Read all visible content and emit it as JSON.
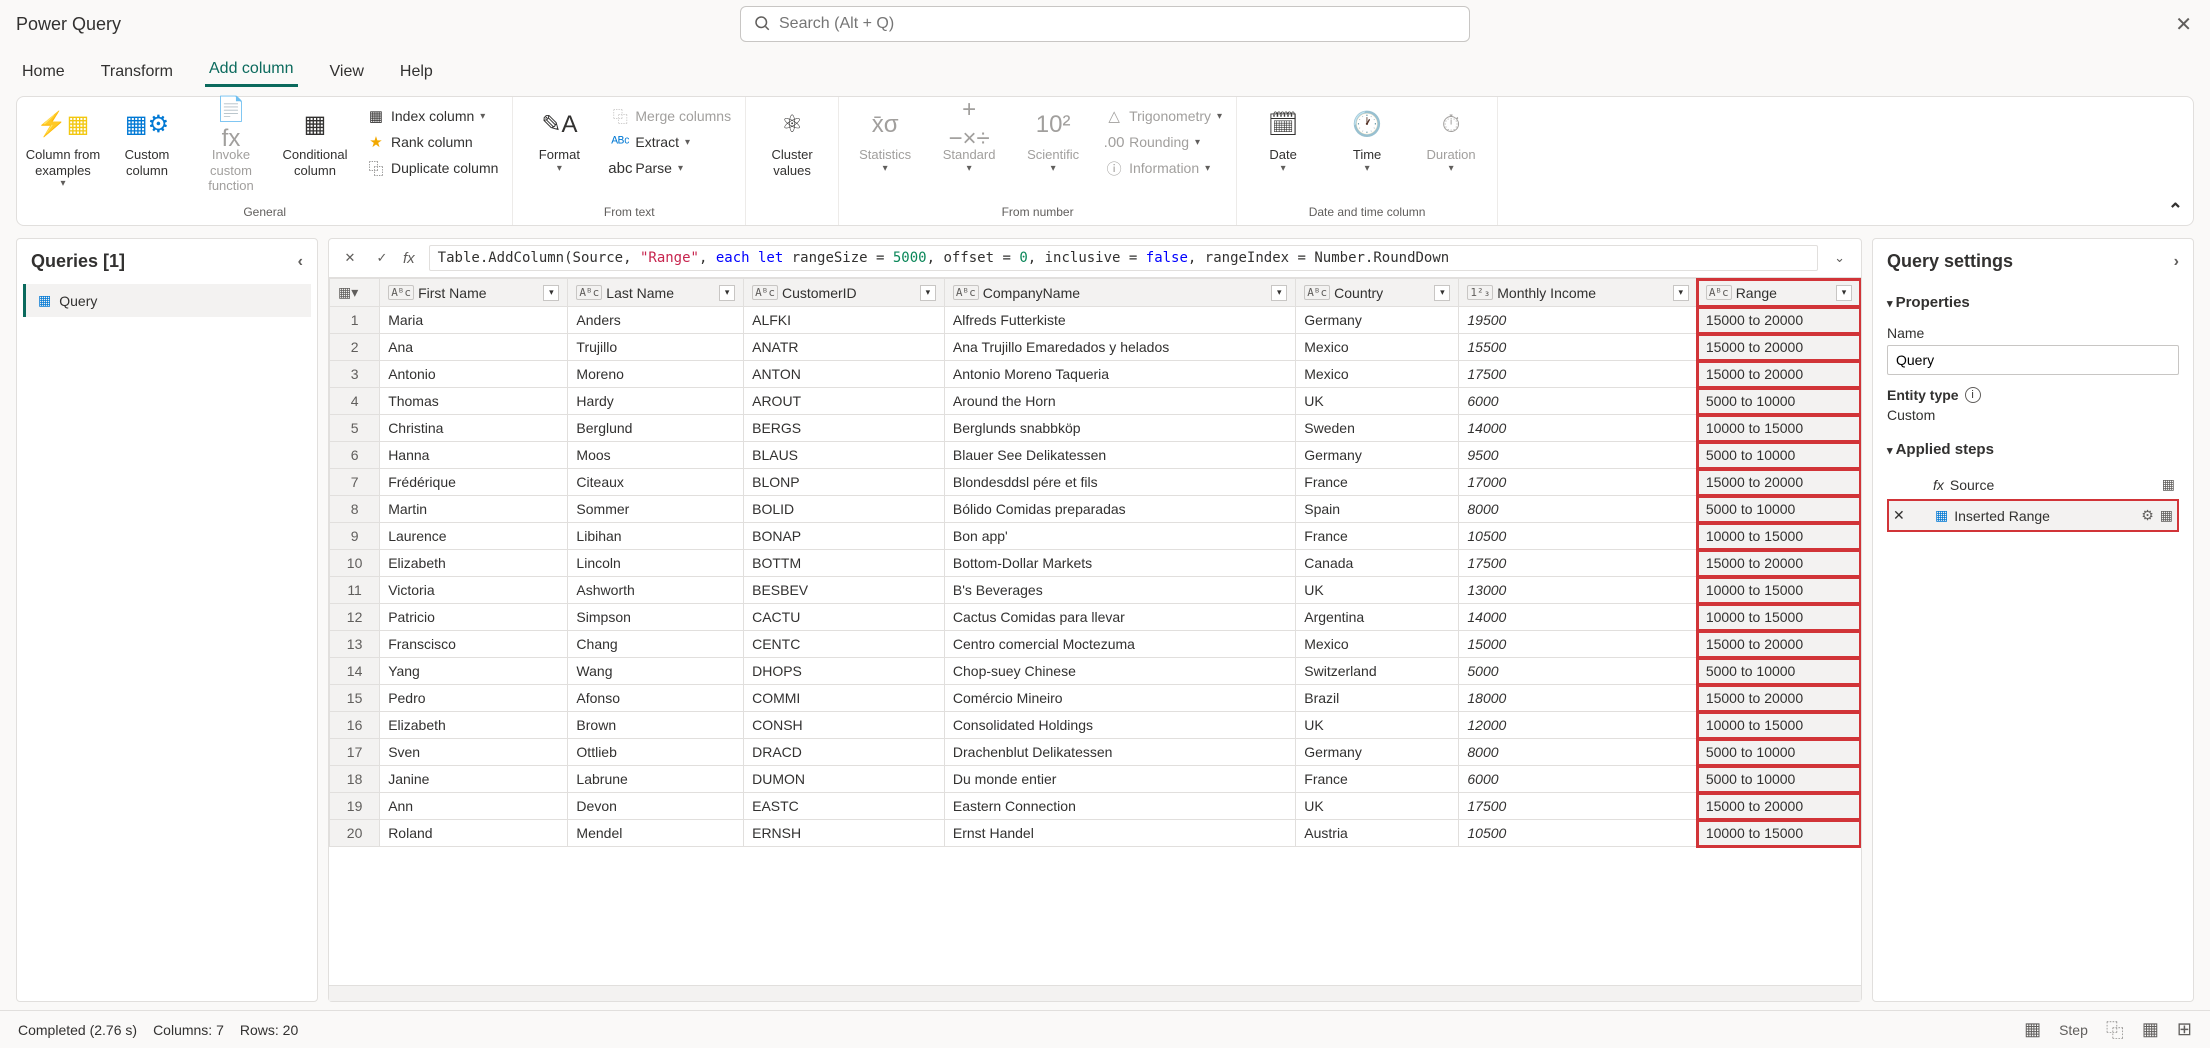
{
  "app": {
    "title": "Power Query",
    "search_placeholder": "Search (Alt + Q)"
  },
  "tabs": {
    "home": "Home",
    "transform": "Transform",
    "add_column": "Add column",
    "view": "View",
    "help": "Help"
  },
  "ribbon": {
    "general": {
      "label": "General",
      "column_from_examples": "Column from examples",
      "custom_column": "Custom column",
      "invoke_custom_function": "Invoke custom function",
      "conditional_column": "Conditional column",
      "index_column": "Index column",
      "rank_column": "Rank column",
      "duplicate_column": "Duplicate column"
    },
    "from_text": {
      "label": "From text",
      "format": "Format",
      "merge_columns": "Merge columns",
      "extract": "Extract",
      "parse": "Parse"
    },
    "cluster": {
      "cluster_values": "Cluster values"
    },
    "from_number": {
      "label": "From number",
      "statistics": "Statistics",
      "standard": "Standard",
      "scientific": "Scientific",
      "trigonometry": "Trigonometry",
      "rounding": "Rounding",
      "information": "Information"
    },
    "date_time": {
      "label": "Date and time column",
      "date": "Date",
      "time": "Time",
      "duration": "Duration"
    }
  },
  "queries": {
    "header": "Queries [1]",
    "items": [
      {
        "name": "Query"
      }
    ]
  },
  "formula": {
    "plain1": "Table.AddColumn(Source, ",
    "str1": "\"Range\"",
    "plain2": ", ",
    "kw_each": "each",
    "kw_let": "let",
    "plain3": " rangeSize = ",
    "num1": "5000",
    "plain4": ", offset = ",
    "num2": "0",
    "plain5": ", inclusive = ",
    "kw_false": "false",
    "plain6": ", rangeIndex = Number.RoundDown"
  },
  "columns": {
    "first_name": "First Name",
    "last_name": "Last Name",
    "customer_id": "CustomerID",
    "company_name": "CompanyName",
    "country": "Country",
    "monthly_income": "Monthly Income",
    "range": "Range"
  },
  "rows": [
    {
      "n": "1",
      "first": "Maria",
      "last": "Anders",
      "cid": "ALFKI",
      "company": "Alfreds Futterkiste",
      "country": "Germany",
      "income": "19500",
      "range": "15000 to 20000"
    },
    {
      "n": "2",
      "first": "Ana",
      "last": "Trujillo",
      "cid": "ANATR",
      "company": "Ana Trujillo Emaredados y helados",
      "country": "Mexico",
      "income": "15500",
      "range": "15000 to 20000"
    },
    {
      "n": "3",
      "first": "Antonio",
      "last": "Moreno",
      "cid": "ANTON",
      "company": "Antonio Moreno Taqueria",
      "country": "Mexico",
      "income": "17500",
      "range": "15000 to 20000"
    },
    {
      "n": "4",
      "first": "Thomas",
      "last": "Hardy",
      "cid": "AROUT",
      "company": "Around the Horn",
      "country": "UK",
      "income": "6000",
      "range": "5000 to 10000"
    },
    {
      "n": "5",
      "first": "Christina",
      "last": "Berglund",
      "cid": "BERGS",
      "company": "Berglunds snabbköp",
      "country": "Sweden",
      "income": "14000",
      "range": "10000 to 15000"
    },
    {
      "n": "6",
      "first": "Hanna",
      "last": "Moos",
      "cid": "BLAUS",
      "company": "Blauer See Delikatessen",
      "country": "Germany",
      "income": "9500",
      "range": "5000 to 10000"
    },
    {
      "n": "7",
      "first": "Frédérique",
      "last": "Citeaux",
      "cid": "BLONP",
      "company": "Blondesddsl pére et fils",
      "country": "France",
      "income": "17000",
      "range": "15000 to 20000"
    },
    {
      "n": "8",
      "first": "Martin",
      "last": "Sommer",
      "cid": "BOLID",
      "company": "Bólido Comidas preparadas",
      "country": "Spain",
      "income": "8000",
      "range": "5000 to 10000"
    },
    {
      "n": "9",
      "first": "Laurence",
      "last": "Libihan",
      "cid": "BONAP",
      "company": "Bon app'",
      "country": "France",
      "income": "10500",
      "range": "10000 to 15000"
    },
    {
      "n": "10",
      "first": "Elizabeth",
      "last": "Lincoln",
      "cid": "BOTTM",
      "company": "Bottom-Dollar Markets",
      "country": "Canada",
      "income": "17500",
      "range": "15000 to 20000"
    },
    {
      "n": "11",
      "first": "Victoria",
      "last": "Ashworth",
      "cid": "BESBEV",
      "company": "B's Beverages",
      "country": "UK",
      "income": "13000",
      "range": "10000 to 15000"
    },
    {
      "n": "12",
      "first": "Patricio",
      "last": "Simpson",
      "cid": "CACTU",
      "company": "Cactus Comidas para llevar",
      "country": "Argentina",
      "income": "14000",
      "range": "10000 to 15000"
    },
    {
      "n": "13",
      "first": "Franscisco",
      "last": "Chang",
      "cid": "CENTC",
      "company": "Centro comercial Moctezuma",
      "country": "Mexico",
      "income": "15000",
      "range": "15000 to 20000"
    },
    {
      "n": "14",
      "first": "Yang",
      "last": "Wang",
      "cid": "DHOPS",
      "company": "Chop-suey Chinese",
      "country": "Switzerland",
      "income": "5000",
      "range": "5000 to 10000"
    },
    {
      "n": "15",
      "first": "Pedro",
      "last": "Afonso",
      "cid": "COMMI",
      "company": "Comércio Mineiro",
      "country": "Brazil",
      "income": "18000",
      "range": "15000 to 20000"
    },
    {
      "n": "16",
      "first": "Elizabeth",
      "last": "Brown",
      "cid": "CONSH",
      "company": "Consolidated Holdings",
      "country": "UK",
      "income": "12000",
      "range": "10000 to 15000"
    },
    {
      "n": "17",
      "first": "Sven",
      "last": "Ottlieb",
      "cid": "DRACD",
      "company": "Drachenblut Delikatessen",
      "country": "Germany",
      "income": "8000",
      "range": "5000 to 10000"
    },
    {
      "n": "18",
      "first": "Janine",
      "last": "Labrune",
      "cid": "DUMON",
      "company": "Du monde entier",
      "country": "France",
      "income": "6000",
      "range": "5000 to 10000"
    },
    {
      "n": "19",
      "first": "Ann",
      "last": "Devon",
      "cid": "EASTC",
      "company": "Eastern Connection",
      "country": "UK",
      "income": "17500",
      "range": "15000 to 20000"
    },
    {
      "n": "20",
      "first": "Roland",
      "last": "Mendel",
      "cid": "ERNSH",
      "company": "Ernst Handel",
      "country": "Austria",
      "income": "10500",
      "range": "10000 to 15000"
    }
  ],
  "settings": {
    "title": "Query settings",
    "properties": "Properties",
    "name_label": "Name",
    "name_value": "Query",
    "entity_type_label": "Entity type",
    "entity_type_value": "Custom",
    "applied_steps": "Applied steps",
    "steps": [
      {
        "label": "Source"
      },
      {
        "label": "Inserted Range"
      }
    ]
  },
  "status": {
    "completed": "Completed (2.76 s)",
    "columns": "Columns: 7",
    "rows": "Rows: 20",
    "step_label": "Step"
  }
}
